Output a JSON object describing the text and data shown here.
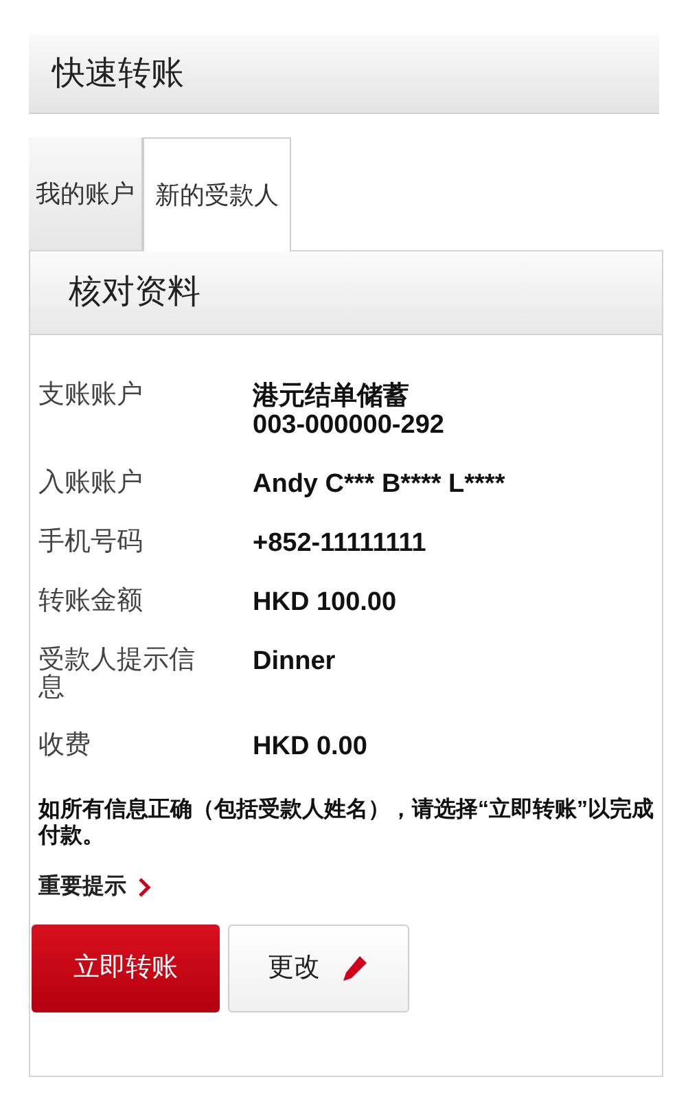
{
  "page_title": "快速转账",
  "tabs": [
    {
      "label": "我的账户",
      "selected": false
    },
    {
      "label": "新的受款人",
      "selected": true
    }
  ],
  "panel": {
    "title": "核对资料",
    "rows": [
      {
        "label": "支账账户",
        "value_lines": [
          "港元结单储蓄",
          "003-000000-292"
        ]
      },
      {
        "label": "入账账户",
        "value_lines": [
          "Andy C*** B**** L****"
        ]
      },
      {
        "label": "手机号码",
        "value_lines": [
          "+852-11111111"
        ]
      },
      {
        "label": "转账金额",
        "value_lines": [
          "HKD 100.00"
        ]
      },
      {
        "label": "受款人提示信息",
        "value_lines": [
          "Dinner"
        ]
      },
      {
        "label": "收费",
        "value_lines": [
          "HKD 0.00"
        ]
      }
    ],
    "notice": "如所有信息正确（包括受款人姓名），请选择“立即转账”以完成付款。",
    "link": "重要提示",
    "buttons": [
      {
        "label": "立即转账",
        "kind": "primary"
      },
      {
        "label": "更改",
        "kind": "edit"
      }
    ]
  }
}
